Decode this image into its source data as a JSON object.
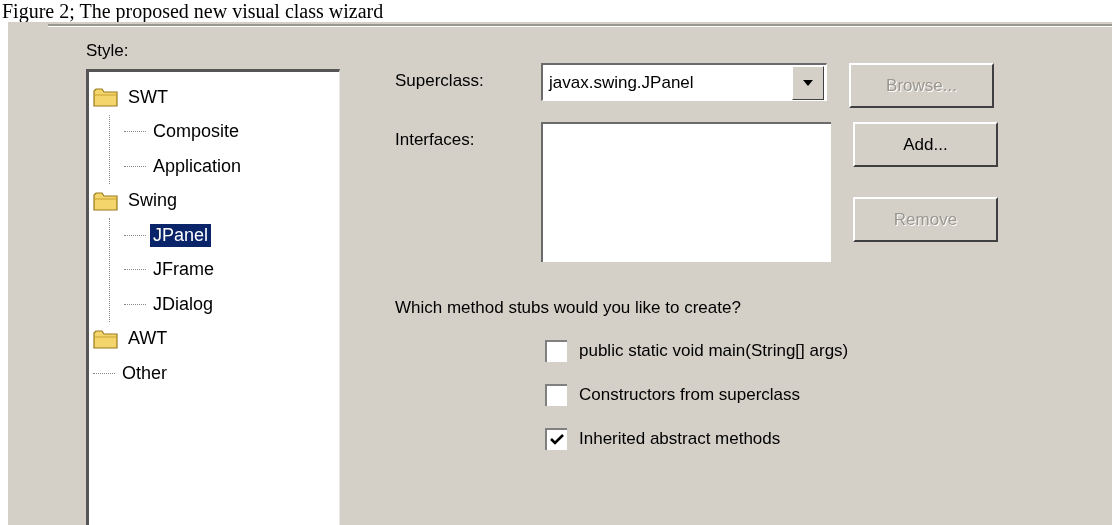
{
  "caption": "Figure 2; The proposed new visual class wizard",
  "style_tree": {
    "label": "Style:",
    "items": [
      {
        "label": "SWT",
        "kind": "folder",
        "selected": false,
        "children": [
          {
            "label": "Composite",
            "kind": "leaf",
            "selected": false
          },
          {
            "label": "Application",
            "kind": "leaf",
            "selected": false
          }
        ]
      },
      {
        "label": "Swing",
        "kind": "folder",
        "selected": false,
        "children": [
          {
            "label": "JPanel",
            "kind": "leaf",
            "selected": true
          },
          {
            "label": "JFrame",
            "kind": "leaf",
            "selected": false
          },
          {
            "label": "JDialog",
            "kind": "leaf",
            "selected": false
          }
        ]
      },
      {
        "label": "AWT",
        "kind": "folder",
        "selected": false
      },
      {
        "label": "Other",
        "kind": "leaf",
        "selected": false
      }
    ]
  },
  "superclass": {
    "label": "Superclass:",
    "value": "javax.swing.JPanel",
    "button": {
      "label": "Browse...",
      "disabled": true
    }
  },
  "interfaces": {
    "label": "Interfaces:",
    "buttons": [
      {
        "label": "Add...",
        "disabled": false
      },
      {
        "label": "Remove",
        "disabled": true
      }
    ]
  },
  "stubs": {
    "question": "Which method stubs would you like to create?",
    "options": [
      {
        "label": "public static void main(String[] args)",
        "checked": false
      },
      {
        "label": "Constructors from superclass",
        "checked": false
      },
      {
        "label": "Inherited abstract methods",
        "checked": true
      }
    ]
  }
}
